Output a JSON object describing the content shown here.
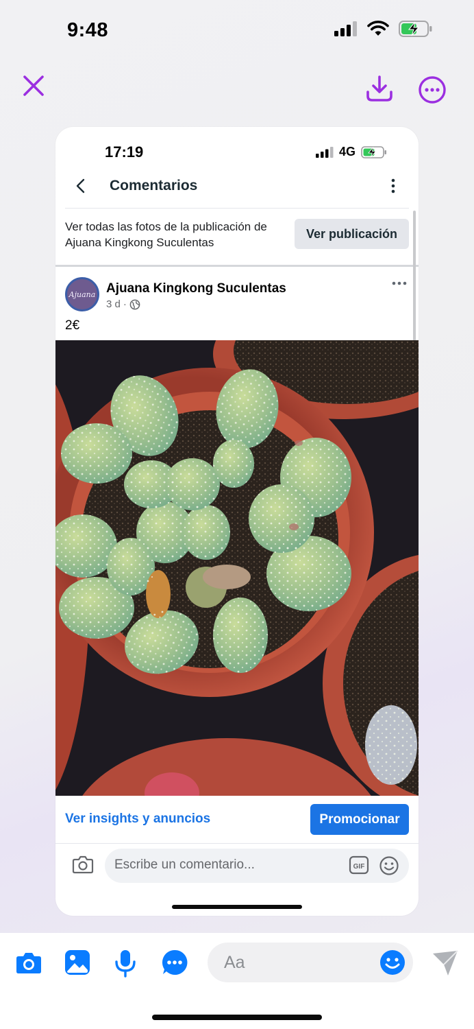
{
  "status_bar": {
    "time": "9:48"
  },
  "viewer": {
    "accent_color": "#9b2fe0"
  },
  "shared_screenshot": {
    "status_bar": {
      "time": "17:19",
      "network": "4G"
    },
    "header": {
      "title": "Comentarios"
    },
    "banner": {
      "text": "Ver todas las fotos de la publicación de Ajuana Kingkong Suculentas",
      "button_label": "Ver publicación"
    },
    "post": {
      "author": "Ajuana Kingkong Suculentas",
      "avatar_text": "Ajuana",
      "time_ago": "3 d",
      "separator": "·",
      "text": "2€"
    },
    "actions": {
      "insights_label": "Ver insights y anuncios",
      "promote_label": "Promocionar"
    },
    "comment": {
      "placeholder": "Escribe un comentario..."
    },
    "colors": {
      "facebook_blue": "#1b74e4"
    }
  },
  "composer": {
    "placeholder": "Aa",
    "accent_color": "#0a7cff"
  }
}
